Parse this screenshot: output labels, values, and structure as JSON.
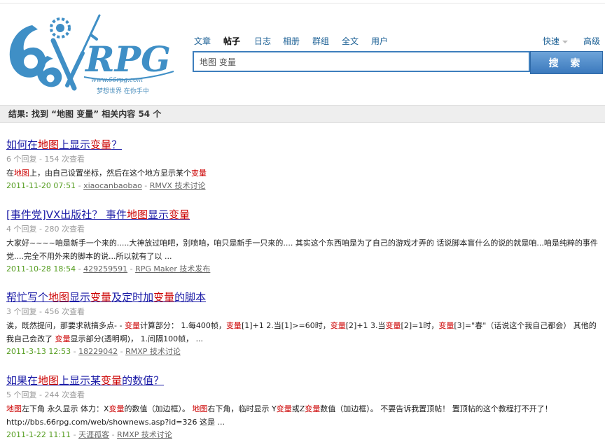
{
  "logo": {
    "url_text": "www.66rpg.com",
    "slogan": "梦想世界 在你手中"
  },
  "nav": {
    "tabs": [
      {
        "label": "文章",
        "active": false
      },
      {
        "label": "帖子",
        "active": true
      },
      {
        "label": "日志",
        "active": false
      },
      {
        "label": "相册",
        "active": false
      },
      {
        "label": "群组",
        "active": false
      },
      {
        "label": "全文",
        "active": false
      },
      {
        "label": "用户",
        "active": false
      }
    ],
    "quick": "快速",
    "advanced": "高级"
  },
  "search": {
    "query": "地图 变量",
    "button": "搜 索"
  },
  "results_summary": "结果: 找到 “地图 变量” 相关内容 54 个",
  "results": [
    {
      "title": [
        {
          "t": "如何在",
          "hl": false
        },
        {
          "t": "地图",
          "hl": true
        },
        {
          "t": "上显示",
          "hl": false
        },
        {
          "t": "变量",
          "hl": true
        },
        {
          "t": "？",
          "hl": false
        }
      ],
      "meta": "6 个回复 - 154 次查看",
      "snippet": [
        {
          "t": "在",
          "hl": false
        },
        {
          "t": "地图",
          "hl": true
        },
        {
          "t": "上，由自己设置坐标，然后在这个地方显示某个",
          "hl": false
        },
        {
          "t": "变量",
          "hl": true
        }
      ],
      "date": "2011-11-20 07:51",
      "author": "xiaocanbaobao",
      "forum": "RMVX 技术讨论"
    },
    {
      "title": [
        {
          "t": "[事件党]VX出版社？ 事件",
          "hl": false
        },
        {
          "t": "地图",
          "hl": true
        },
        {
          "t": "显示",
          "hl": false
        },
        {
          "t": "变量",
          "hl": true
        }
      ],
      "meta": "4 个回复 - 280 次查看",
      "snippet": [
        {
          "t": "大家好~~~~咱是新手一个来的.....大神放过咱吧，别喷咱，咱只是新手一只来的.... 其实这个东西咱是为了自己的游戏才弄的 话说脚本盲什么的说的就是咱...咱是纯粹的事件党....完全不用外来的脚本的说...所以就有了以 ...",
          "hl": false
        }
      ],
      "date": "2011-10-28 18:54",
      "author": "429259591",
      "forum": "RPG Maker 技术发布"
    },
    {
      "title": [
        {
          "t": "帮忙写个",
          "hl": false
        },
        {
          "t": "地图",
          "hl": true
        },
        {
          "t": "显示",
          "hl": false
        },
        {
          "t": "变量",
          "hl": true
        },
        {
          "t": "及定时加",
          "hl": false
        },
        {
          "t": "变量",
          "hl": true
        },
        {
          "t": "的脚本",
          "hl": false
        }
      ],
      "meta": "3 个回复 - 456 次查看",
      "snippet": [
        {
          "t": "诶，既然提问，那要求就搞多点- - ",
          "hl": false
        },
        {
          "t": "变量",
          "hl": true
        },
        {
          "t": "计算部分： 1.每400帧，",
          "hl": false
        },
        {
          "t": "变量",
          "hl": true
        },
        {
          "t": "[1]+1 2.当[1]>=60时，",
          "hl": false
        },
        {
          "t": "变量",
          "hl": true
        },
        {
          "t": "[2]+1 3.当",
          "hl": false
        },
        {
          "t": "变量",
          "hl": true
        },
        {
          "t": "[2]=1时，",
          "hl": false
        },
        {
          "t": "变量",
          "hl": true
        },
        {
          "t": "[3]=\"春\"（话说这个我自己都会） 其他的我自己会改了 ",
          "hl": false
        },
        {
          "t": "变量",
          "hl": true
        },
        {
          "t": "显示部分(透明啊)， 1.间隔100帧， ...",
          "hl": false
        }
      ],
      "date": "2011-3-13 12:53",
      "author": "18229042",
      "forum": "RMXP 技术讨论"
    },
    {
      "title": [
        {
          "t": "如果在",
          "hl": false
        },
        {
          "t": "地图",
          "hl": true
        },
        {
          "t": "上显示某",
          "hl": false
        },
        {
          "t": "变量",
          "hl": true
        },
        {
          "t": "的数值？",
          "hl": false
        }
      ],
      "meta": "5 个回复 - 244 次查看",
      "snippet": [
        {
          "t": "地图",
          "hl": true
        },
        {
          "t": "左下角 永久显示 体力：X",
          "hl": false
        },
        {
          "t": "变量",
          "hl": true
        },
        {
          "t": "的数值（加边框）。 ",
          "hl": false
        },
        {
          "t": "地图",
          "hl": true
        },
        {
          "t": "右下角，临时显示 Y",
          "hl": false
        },
        {
          "t": "变量",
          "hl": true
        },
        {
          "t": "或Z",
          "hl": false
        },
        {
          "t": "变量",
          "hl": true
        },
        {
          "t": "数值（加边框）。 不要告诉我置顶帖！ 置顶帖的这个教程打不开了！ http://bbs.66rpg.com/web/shownews.asp?id=326 这是 ...",
          "hl": false
        }
      ],
      "date": "2011-1-22 11:11",
      "author": "天涯孤客",
      "forum": "RMXP 技术讨论"
    }
  ]
}
